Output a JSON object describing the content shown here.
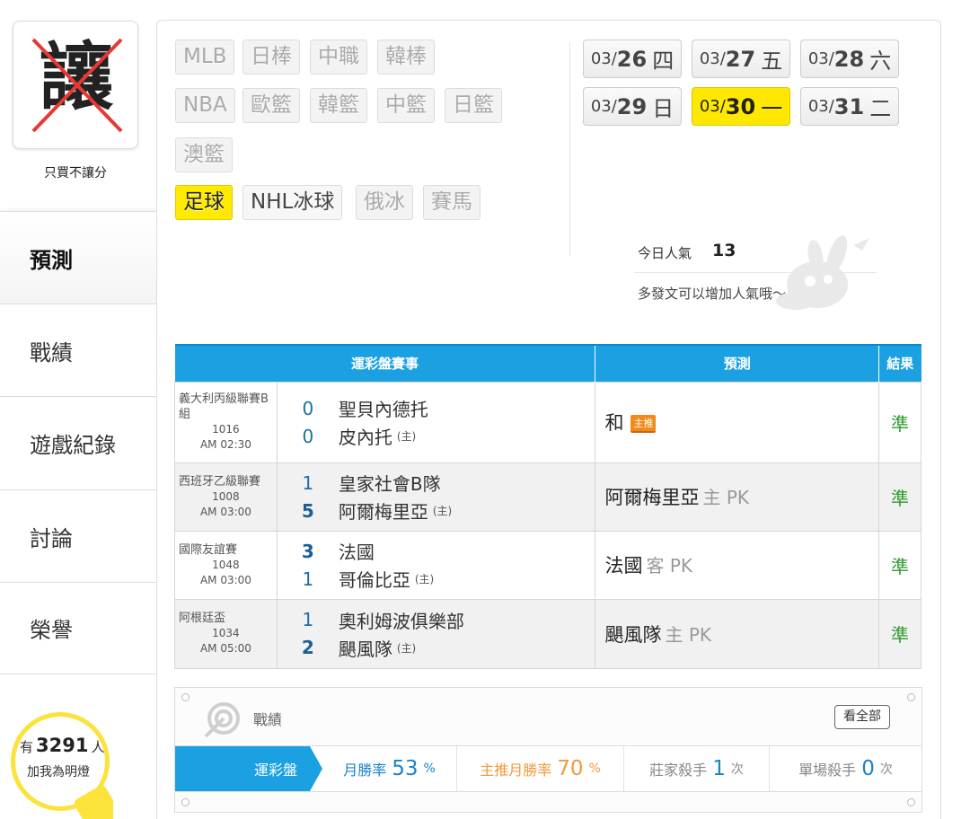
{
  "sidebar": {
    "badge_glyph": "讓",
    "badge_caption": "只買不讓分",
    "items": [
      {
        "label": "預測",
        "active": true
      },
      {
        "label": "戰績",
        "active": false
      },
      {
        "label": "遊戲紀錄",
        "active": false
      },
      {
        "label": "討論",
        "active": false
      },
      {
        "label": "榮譽",
        "active": false
      }
    ],
    "lamp": {
      "prefix": "有",
      "count": "3291",
      "suffix": "人",
      "line2": "加我為明燈"
    }
  },
  "sports": {
    "tags": [
      {
        "label": "MLB",
        "state": "enabled"
      },
      {
        "label": "日棒",
        "state": "disabled"
      },
      {
        "label": "中職",
        "state": "disabled"
      },
      {
        "label": "韓棒",
        "state": "disabled"
      },
      {
        "label": "NBA",
        "state": "enabled"
      },
      {
        "label": "歐籃",
        "state": "disabled"
      },
      {
        "label": "韓籃",
        "state": "disabled"
      },
      {
        "label": "中籃",
        "state": "disabled"
      },
      {
        "label": "日籃",
        "state": "disabled"
      },
      {
        "label": "澳籃",
        "state": "disabled"
      },
      {
        "label": "足球",
        "state": "selected"
      },
      {
        "label": "NHL冰球",
        "state": "enabled"
      },
      {
        "label": "俄冰",
        "state": "disabled"
      },
      {
        "label": "賽馬",
        "state": "disabled"
      }
    ]
  },
  "dates": [
    {
      "md": "03/",
      "d": "26",
      "wd": "四",
      "selected": false
    },
    {
      "md": "03/",
      "d": "27",
      "wd": "五",
      "selected": false
    },
    {
      "md": "03/",
      "d": "28",
      "wd": "六",
      "selected": false
    },
    {
      "md": "03/",
      "d": "29",
      "wd": "日",
      "selected": false
    },
    {
      "md": "03/",
      "d": "30",
      "wd": "一",
      "selected": true
    },
    {
      "md": "03/",
      "d": "31",
      "wd": "二",
      "selected": false
    }
  ],
  "popularity": {
    "label": "今日人氣",
    "value": "13",
    "hint": "多發文可以增加人氣哦～"
  },
  "table": {
    "headers": [
      "運彩盤賽事",
      "預測",
      "結果"
    ],
    "rows": [
      {
        "league": "義大利丙級聯賽B組",
        "no": "1016",
        "time": "AM 02:30",
        "team1": {
          "score": "0",
          "name": "聖貝內德托",
          "win": false
        },
        "team2": {
          "score": "0",
          "name": "皮內托",
          "home": "(主)",
          "win": false
        },
        "pred": "和",
        "pred_sub": "",
        "pred_badge": "主推",
        "result": "準"
      },
      {
        "league": "西班牙乙級聯賽",
        "no": "1008",
        "time": "AM 03:00",
        "team1": {
          "score": "1",
          "name": "皇家社會B隊",
          "win": false
        },
        "team2": {
          "score": "5",
          "name": "阿爾梅里亞",
          "home": "(主)",
          "win": true
        },
        "pred": "阿爾梅里亞",
        "pred_sub": "主 PK",
        "pred_badge": "",
        "result": "準"
      },
      {
        "league": "國際友誼賽",
        "no": "1048",
        "time": "AM 03:00",
        "team1": {
          "score": "3",
          "name": "法國",
          "win": true
        },
        "team2": {
          "score": "1",
          "name": "哥倫比亞",
          "home": "(主)",
          "win": false
        },
        "pred": "法國",
        "pred_sub": "客 PK",
        "pred_badge": "",
        "result": "準"
      },
      {
        "league": "阿根廷盃",
        "no": "1034",
        "time": "AM 05:00",
        "team1": {
          "score": "1",
          "name": "奧利姆波俱樂部",
          "win": false
        },
        "team2": {
          "score": "2",
          "name": "颶風隊",
          "home": "(主)",
          "win": true
        },
        "pred": "颶風隊",
        "pred_sub": "主 PK",
        "pred_badge": "",
        "result": "準"
      }
    ]
  },
  "record": {
    "title": "戰績",
    "view_all": "看全部",
    "category": "運彩盤",
    "stats": [
      {
        "label": "月勝率",
        "value": "53",
        "unit": "%",
        "tone": "blue"
      },
      {
        "label": "主推月勝率",
        "value": "70",
        "unit": "%",
        "tone": "orange"
      },
      {
        "label": "莊家殺手",
        "value": "1",
        "unit": "次",
        "tone": "grey"
      },
      {
        "label": "單場殺手",
        "value": "0",
        "unit": "次",
        "tone": "grey"
      }
    ]
  },
  "colors": {
    "accent_blue": "#1ba1e2",
    "highlight_yellow": "#ffea00",
    "result_green": "#2d9a2d",
    "badge_orange": "#f08a18"
  }
}
